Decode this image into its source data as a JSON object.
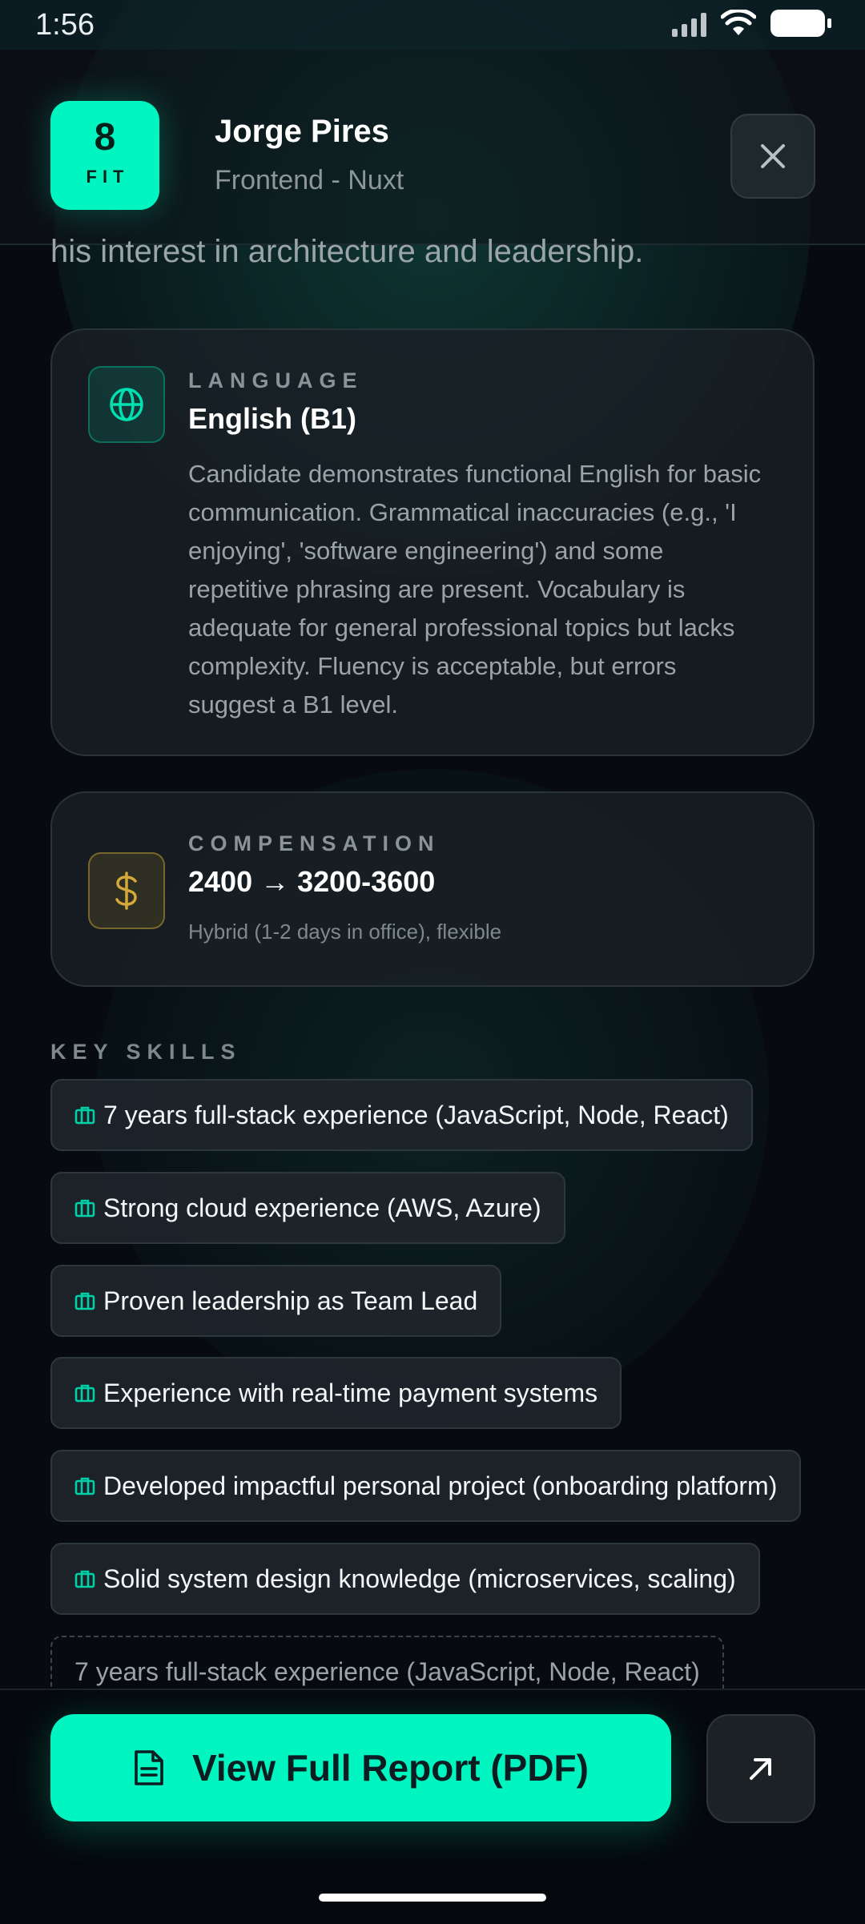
{
  "status_bar": {
    "time": "1:56"
  },
  "header": {
    "fit_score": "8",
    "fit_label": "FIT",
    "name": "Jorge Pires",
    "role": "Frontend - Nuxt"
  },
  "summary_tail": "his interest in architecture and leadership.",
  "language": {
    "eyebrow": "LANGUAGE",
    "title": "English (B1)",
    "body": "Candidate demonstrates functional English for basic communication. Grammatical inaccuracies (e.g., 'I enjoying', 'software engineering') and some repetitive phrasing are present. Vocabulary is adequate for general professional topics but lacks complexity. Fluency is acceptable, but errors suggest a B1 level."
  },
  "compensation": {
    "eyebrow": "COMPENSATION",
    "title": "2400 → 3200-3600",
    "subtitle": "Hybrid (1-2 days in office), flexible"
  },
  "key_skills": {
    "title": "KEY SKILLS",
    "items": [
      "7 years full-stack experience (JavaScript, Node, React)",
      "Strong cloud experience (AWS, Azure)",
      "Proven leadership as Team Lead",
      "Experience with real-time payment systems",
      "Developed impactful personal project (onboarding platform)",
      "Solid system design knowledge (microservices, scaling)"
    ],
    "overflow_item": "7 years full-stack experience (JavaScript, Node, React)"
  },
  "actions": {
    "view_report_label": "View Full Report (PDF)"
  },
  "colors": {
    "accent": "#00f5c0",
    "background": "#070a10",
    "card": "#1a2026",
    "gold": "#d4a93a"
  }
}
